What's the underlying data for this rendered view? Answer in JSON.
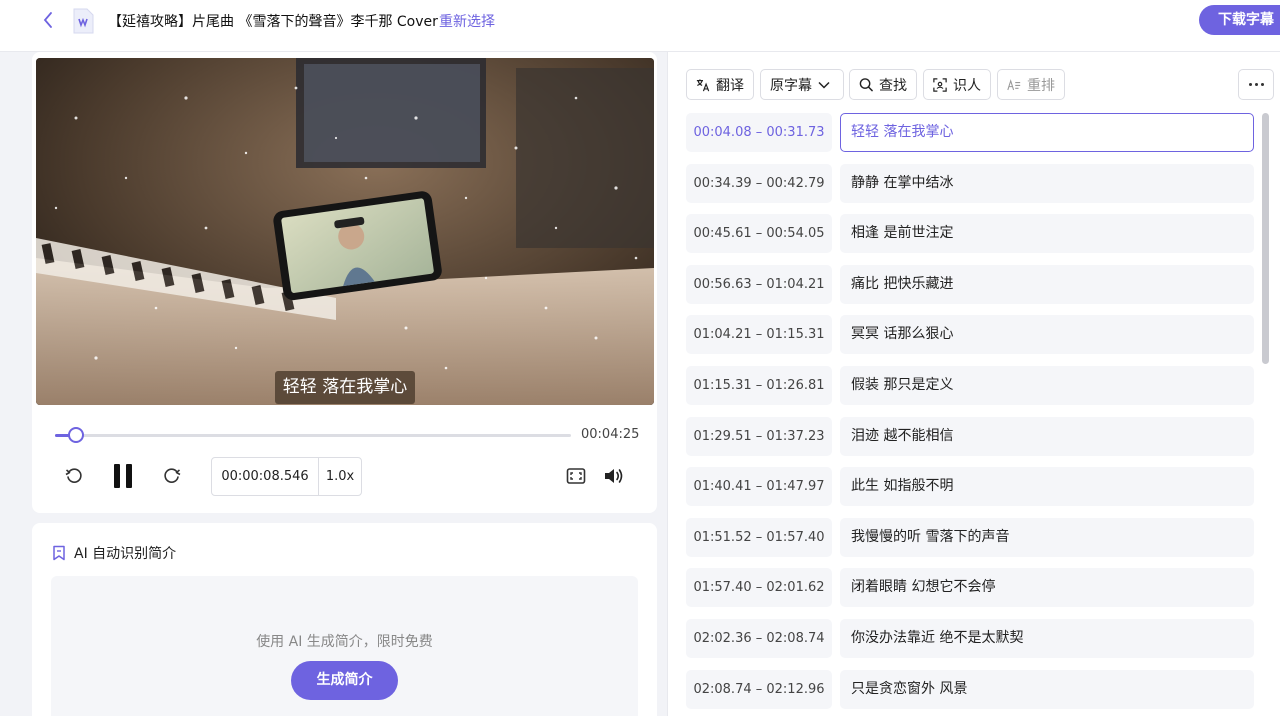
{
  "header": {
    "title": "【延禧攻略】片尾曲 《雪落下的聲音》李千那 Cover",
    "reselect": "重新选择",
    "download": "下载字幕"
  },
  "player": {
    "subtitle": "轻轻 落在我掌心",
    "duration": "00:04:25",
    "current_time": "00:00:08.546",
    "speed": "1.0x",
    "progress": 0.041
  },
  "ai": {
    "heading": "AI 自动识别简介",
    "hint": "使用 AI 生成简介，限时免费",
    "generate": "生成简介"
  },
  "toolbar": {
    "translate": "翻译",
    "original": "原字幕",
    "find": "查找",
    "recognize": "识人",
    "reflow": "重排"
  },
  "subtitles": [
    {
      "time": "00:04.08 – 00:31.73",
      "text": "轻轻 落在我掌心"
    },
    {
      "time": "00:34.39 – 00:42.79",
      "text": "静静 在掌中结冰"
    },
    {
      "time": "00:45.61 – 00:54.05",
      "text": "相逢 是前世注定"
    },
    {
      "time": "00:56.63 – 01:04.21",
      "text": "痛比 把快乐藏进"
    },
    {
      "time": "01:04.21 – 01:15.31",
      "text": "冥冥 话那么狠心"
    },
    {
      "time": "01:15.31 – 01:26.81",
      "text": "假装 那只是定义"
    },
    {
      "time": "01:29.51 – 01:37.23",
      "text": "泪迹 越不能相信"
    },
    {
      "time": "01:40.41 – 01:47.97",
      "text": "此生 如指般不明"
    },
    {
      "time": "01:51.52 – 01:57.40",
      "text": "我慢慢的听 雪落下的声音"
    },
    {
      "time": "01:57.40 – 02:01.62",
      "text": "闭着眼睛 幻想它不会停"
    },
    {
      "time": "02:02.36 – 02:08.74",
      "text": "你没办法靠近 绝不是太默契"
    },
    {
      "time": "02:08.74 – 02:12.96",
      "text": "只是贪恋窗外 风景"
    }
  ],
  "colors": {
    "accent": "#6e63e0"
  }
}
